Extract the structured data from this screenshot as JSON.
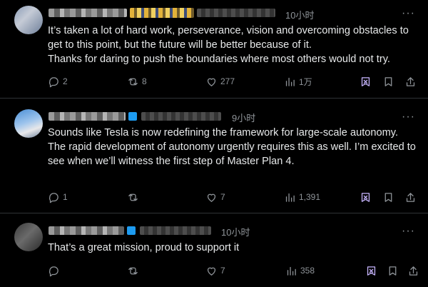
{
  "posts": [
    {
      "time": "10小时",
      "text": [
        "It’s taken a lot of hard work, perseverance, vision and overcoming obstacles to get to this point, but the future will be better because of it.",
        "Thanks for daring to push the boundaries where most others would not try."
      ],
      "replies": "2",
      "reposts": "8",
      "likes": "277",
      "views": "1万"
    },
    {
      "time": "9小时",
      "text": [
        "Sounds like Tesla is now redefining the framework for large-scale autonomy.",
        "The rapid development of autonomy urgently requires this as well. I’m excited to see when we’ll witness the first step of Master Plan 4."
      ],
      "replies": "1",
      "reposts": "",
      "likes": "7",
      "views": "1,391"
    },
    {
      "time": "10小时",
      "text": [
        "That’s a great mission, proud to support it"
      ],
      "replies": "",
      "reposts": "",
      "likes": "7",
      "views": "358"
    }
  ],
  "more_label": "···",
  "icons": [
    "reply-icon",
    "repost-icon",
    "like-icon",
    "views-icon",
    "grok-icon",
    "bookmark-icon",
    "share-icon"
  ]
}
